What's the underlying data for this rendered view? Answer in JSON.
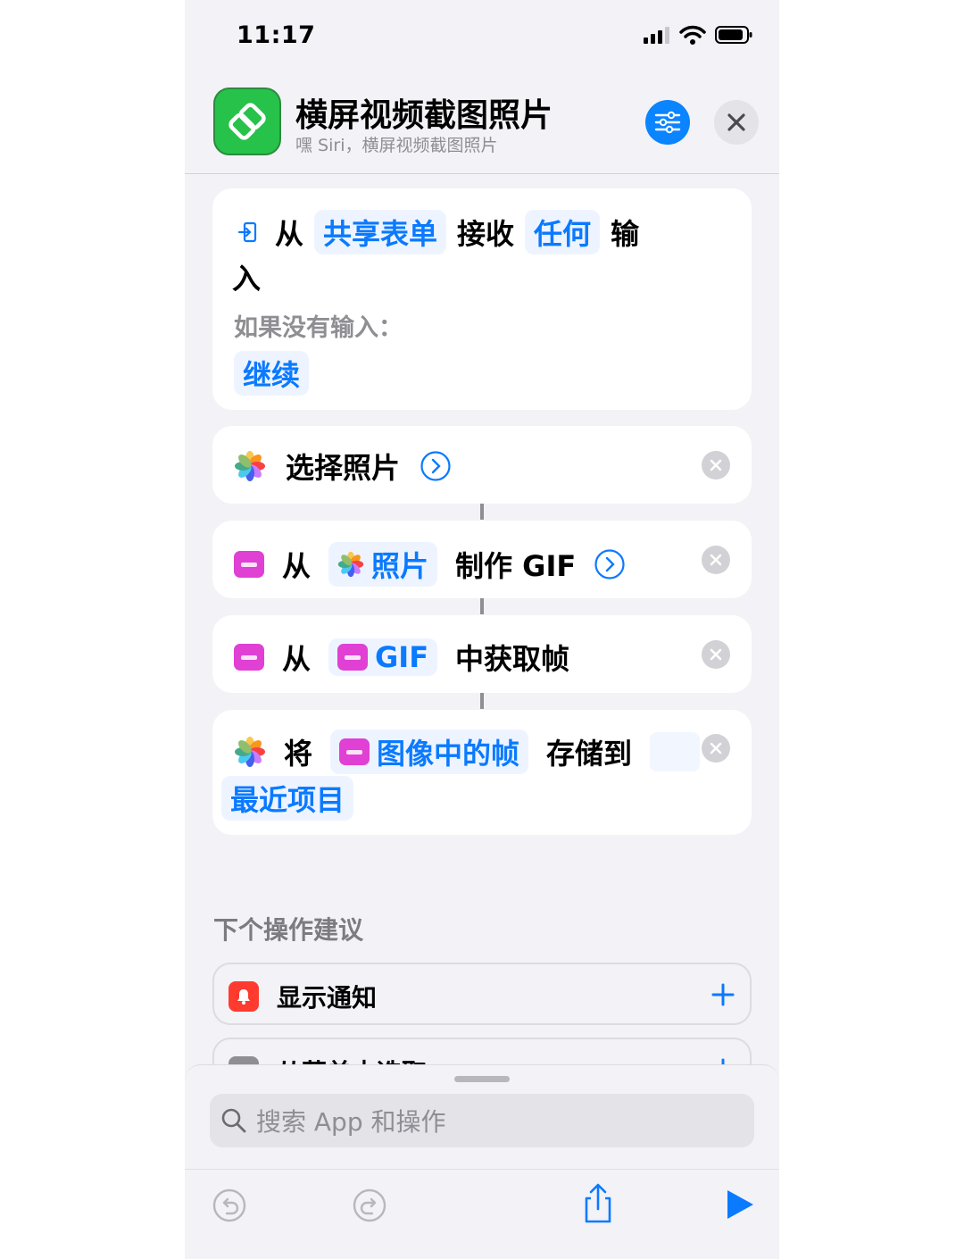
{
  "status": {
    "time": "11:17"
  },
  "header": {
    "title": "横屏视频截图照片",
    "subtitle": "嘿 Siri，横屏视频截图照片"
  },
  "actions": {
    "receive": {
      "from": "从",
      "source": "共享表单",
      "receive": "接收",
      "type": "任何",
      "input_1": "输",
      "input_2": "入",
      "if_none": "如果没有输入：",
      "continue": "继续"
    },
    "select_photos": {
      "label": "选择照片"
    },
    "make_gif": {
      "from": "从",
      "source": "照片",
      "label": "制作 GIF"
    },
    "get_frames": {
      "from": "从",
      "source": "GIF",
      "label": "中获取帧"
    },
    "save": {
      "will": "将",
      "source": "图像中的帧",
      "label": "存储到",
      "album": "最近项目"
    }
  },
  "suggestions": {
    "title": "下个操作建议",
    "items": [
      {
        "label": "显示通知",
        "color": "#ff3b30"
      },
      {
        "label": "从菜单中选取",
        "color": "#8e8e93"
      }
    ]
  },
  "search": {
    "placeholder": "搜索 App 和操作"
  },
  "colors": {
    "accent": "#0a84ff",
    "shortcuts_green": "#27c24a",
    "gif_magenta": "#e040d4"
  }
}
